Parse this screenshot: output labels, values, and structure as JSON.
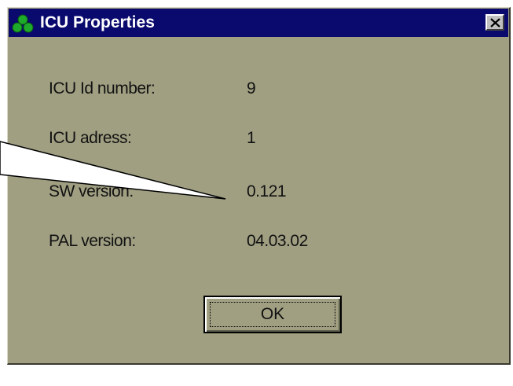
{
  "window": {
    "title": "ICU Properties"
  },
  "properties": [
    {
      "label": "ICU Id number:",
      "value": "9"
    },
    {
      "label": "ICU adress:",
      "value": "1"
    },
    {
      "label": "SW version:",
      "value": "0.121"
    },
    {
      "label": "PAL version:",
      "value": "04.03.02"
    }
  ],
  "buttons": {
    "ok_label": "OK"
  },
  "icons": {
    "app": "three-green-circles-icon",
    "close": "close-icon"
  },
  "colors": {
    "titlebar": "#0a0a6e",
    "dialog_background": "#a09f82",
    "app_icon": "#1eaa2a"
  }
}
